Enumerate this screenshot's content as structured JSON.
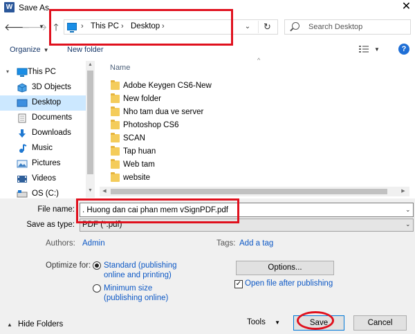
{
  "window": {
    "title": "Save As",
    "app_icon_letter": "W"
  },
  "address_bar": {
    "crumbs": [
      "This PC",
      "Desktop"
    ],
    "separator": "›"
  },
  "search": {
    "placeholder": "Search Desktop"
  },
  "toolbar": {
    "organize_label": "Organize",
    "new_folder_label": "New folder",
    "help_label": "?"
  },
  "nav_pane": {
    "items": [
      {
        "label": "This PC",
        "icon": "computer-icon"
      },
      {
        "label": "3D Objects",
        "icon": "cube-icon"
      },
      {
        "label": "Desktop",
        "icon": "desktop-icon",
        "selected": true
      },
      {
        "label": "Documents",
        "icon": "document-icon"
      },
      {
        "label": "Downloads",
        "icon": "download-icon"
      },
      {
        "label": "Music",
        "icon": "music-icon"
      },
      {
        "label": "Pictures",
        "icon": "pictures-icon"
      },
      {
        "label": "Videos",
        "icon": "video-icon"
      },
      {
        "label": "OS (C:)",
        "icon": "drive-icon"
      }
    ]
  },
  "file_list": {
    "column_header": "Name",
    "folders": [
      "Adobe Keygen CS6-New",
      "New folder",
      "Nho tam dua ve server",
      "Photoshop CS6",
      "SCAN",
      "Tap huan",
      "Web tam",
      "website"
    ]
  },
  "form": {
    "file_name_label": "File name:",
    "file_name_value": ". Huong dan cai phan mem vSignPDF.pdf",
    "save_as_type_label": "Save as type:",
    "save_as_type_value": "PDF (*.pdf)",
    "authors_label": "Authors:",
    "authors_value": "Admin",
    "tags_label": "Tags:",
    "tags_value": "Add a tag",
    "optimize_label": "Optimize for:",
    "optimize_standard_line1": "Standard (publishing",
    "optimize_standard_line2": "online and printing)",
    "optimize_minimum_line1": "Minimum size",
    "optimize_minimum_line2": "(publishing online)",
    "options_label": "Options...",
    "open_after_label": "Open file after publishing",
    "open_after_checked": true
  },
  "footer": {
    "hide_folders_label": "Hide Folders",
    "tools_label": "Tools",
    "save_label": "Save",
    "cancel_label": "Cancel"
  },
  "colors": {
    "annotation_red": "#e0101d",
    "selected_bg": "#cce8ff",
    "link_blue": "#0b57c5",
    "folder_yellow": "#f4cc5b"
  }
}
